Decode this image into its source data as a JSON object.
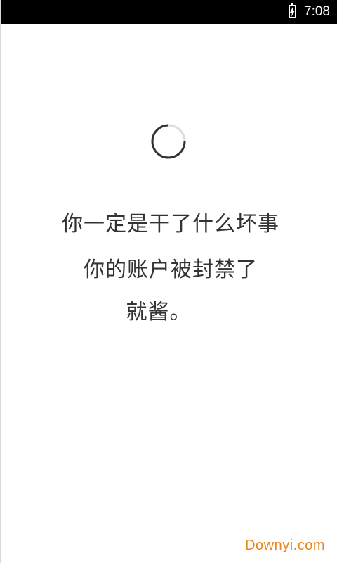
{
  "status_bar": {
    "time": "7:08",
    "battery_icon": "battery-charging-icon"
  },
  "loading": {
    "spinner_icon": "loading-spinner-icon"
  },
  "message": {
    "line1": "你一定是干了什么坏事",
    "line2": "你的账户被封禁了",
    "line3": "就酱。"
  },
  "watermark": {
    "text": "Downyi.com",
    "color": "#e8861a"
  }
}
